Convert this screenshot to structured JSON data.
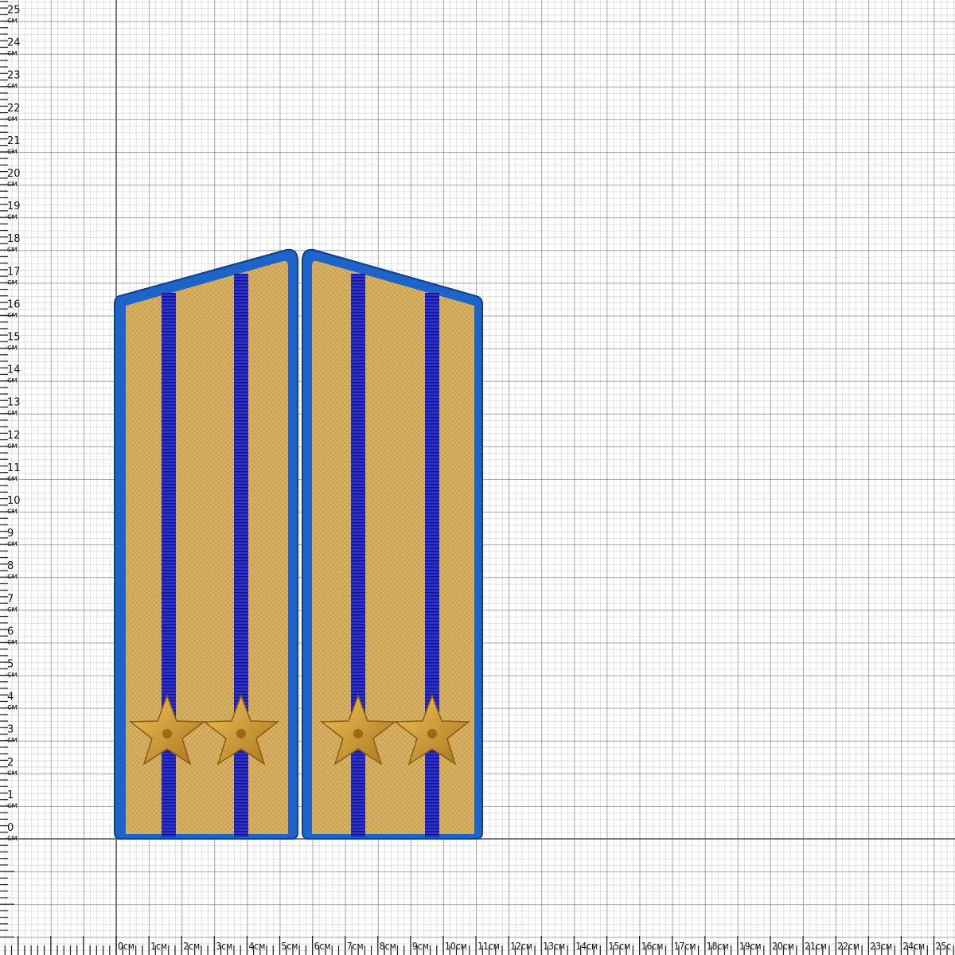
{
  "ruler": {
    "unit": "см",
    "vertical_labels": [
      "25",
      "24",
      "23",
      "22",
      "21",
      "20",
      "19",
      "18",
      "17",
      "16",
      "15",
      "14",
      "13",
      "12",
      "11",
      "10",
      "9",
      "8",
      "7",
      "6",
      "5",
      "4",
      "3",
      "2",
      "1",
      "0"
    ],
    "horizontal_labels": [
      "0см",
      "1см",
      "2см",
      "3см",
      "4см",
      "5см",
      "6см",
      "7см",
      "8см",
      "9см",
      "10см",
      "11см",
      "12см",
      "13см",
      "14см",
      "15см",
      "16см",
      "17см",
      "18см",
      "19см",
      "20см",
      "21см",
      "22см",
      "23см",
      "24см",
      "25c"
    ]
  },
  "photo": {
    "subject": "pair of gold-embroidered shoulder boards with light-blue edging, two dark-blue stripes and two gold stars each",
    "colors": {
      "edging": "#1e63c8",
      "edging_dark": "#0f3f8f",
      "field": "#d2a95a",
      "field_light": "#e3c27a",
      "stripe": "#2a2fd6",
      "stripe_dark": "#1a1a8a",
      "star": "#d8a233",
      "star_dark": "#9b6a14"
    },
    "boards": [
      "left-board",
      "right-board"
    ],
    "stars_per_board": 2,
    "stripes_per_board": 2
  }
}
